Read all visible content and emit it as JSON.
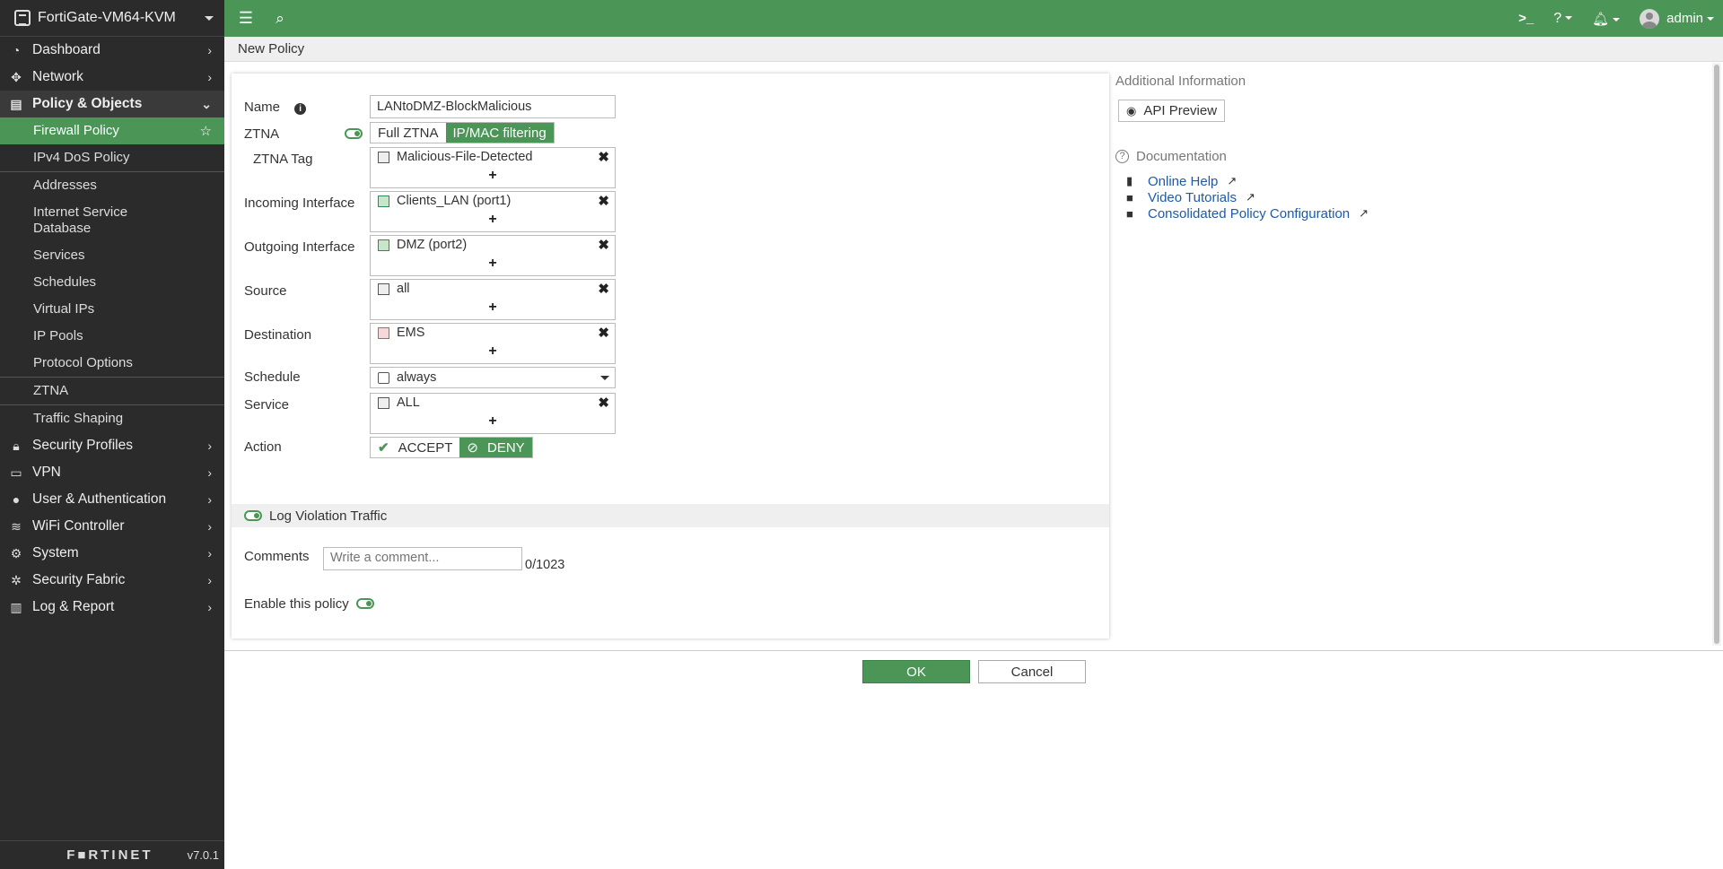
{
  "app": {
    "device_name": "FortiGate-VM64-KVM",
    "brand": "F■RTINET",
    "version": "v7.0.1"
  },
  "sidebar": {
    "items": [
      {
        "label": "Dashboard",
        "icon": "dashboard-icon"
      },
      {
        "label": "Network",
        "icon": "network-icon"
      },
      {
        "label": "Policy & Objects",
        "icon": "policy-icon"
      },
      {
        "label": "Security Profiles",
        "icon": "lock-icon"
      },
      {
        "label": "VPN",
        "icon": "monitor-icon"
      },
      {
        "label": "User & Authentication",
        "icon": "user-icon"
      },
      {
        "label": "WiFi Controller",
        "icon": "wifi-icon"
      },
      {
        "label": "System",
        "icon": "gear-icon"
      },
      {
        "label": "Security Fabric",
        "icon": "fabric-icon"
      },
      {
        "label": "Log & Report",
        "icon": "chart-icon"
      }
    ],
    "sub_items": [
      "Firewall Policy",
      "IPv4 DoS Policy",
      "Addresses",
      "Internet Service Database",
      "Services",
      "Schedules",
      "Virtual IPs",
      "IP Pools",
      "Protocol Options",
      "ZTNA",
      "Traffic Shaping"
    ]
  },
  "topbar": {
    "user": "admin"
  },
  "breadcrumb": "New Policy",
  "form": {
    "name_label": "Name",
    "name_value": "LANtoDMZ-BlockMalicious",
    "ztna_label": "ZTNA",
    "ztna_options": [
      "Full ZTNA",
      "IP/MAC filtering"
    ],
    "ztna_tag_label": "ZTNA Tag",
    "ztna_tag_value": "Malicious-File-Detected",
    "incoming_label": "Incoming Interface",
    "incoming_value": "Clients_LAN (port1)",
    "outgoing_label": "Outgoing Interface",
    "outgoing_value": "DMZ (port2)",
    "source_label": "Source",
    "source_value": "all",
    "destination_label": "Destination",
    "destination_value": "EMS",
    "schedule_label": "Schedule",
    "schedule_value": "always",
    "service_label": "Service",
    "service_value": "ALL",
    "action_label": "Action",
    "action_accept": "ACCEPT",
    "action_deny": "DENY",
    "log_violation": "Log Violation Traffic",
    "comments_label": "Comments",
    "comments_placeholder": "Write a comment...",
    "comments_count": "0/1023",
    "enable_label": "Enable this policy"
  },
  "right_panel": {
    "additional_info": "Additional Information",
    "api_preview": "API Preview",
    "documentation": "Documentation",
    "links": [
      "Online Help",
      "Video Tutorials",
      "Consolidated Policy Configuration"
    ]
  },
  "buttons": {
    "ok": "OK",
    "cancel": "Cancel"
  },
  "colors": {
    "accent": "#4b9657",
    "sidebar_bg": "#2b2b2b",
    "link": "#1e5aa8"
  }
}
